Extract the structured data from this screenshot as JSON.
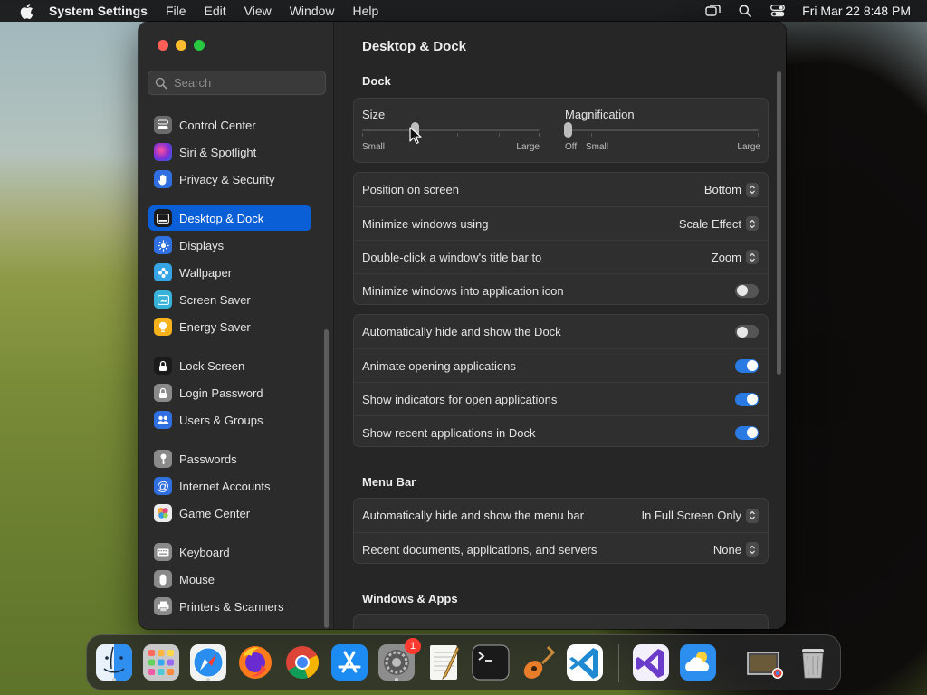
{
  "menubar": {
    "app_name": "System Settings",
    "menus": [
      "File",
      "Edit",
      "View",
      "Window",
      "Help"
    ],
    "clock": "Fri Mar 22  8:48 PM",
    "status_icons": [
      "screen-mirroring-icon",
      "spotlight-search-icon",
      "control-center-icon"
    ]
  },
  "search": {
    "placeholder": "Search"
  },
  "sidebar": {
    "items": [
      {
        "label": "Control Center",
        "icon": "control-center-icon",
        "color": "#6b6b6b"
      },
      {
        "label": "Siri & Spotlight",
        "icon": "siri-icon",
        "color": "#8e3ad6"
      },
      {
        "label": "Privacy & Security",
        "icon": "hand-icon",
        "color": "#2f6fe0"
      },
      {
        "label": "Desktop & Dock",
        "icon": "dock-icon",
        "color": "#1b1b1b",
        "selected": true
      },
      {
        "label": "Displays",
        "icon": "sun-icon",
        "color": "#2f6fe0"
      },
      {
        "label": "Wallpaper",
        "icon": "flower-icon",
        "color": "#35a5e6"
      },
      {
        "label": "Screen Saver",
        "icon": "screen-saver-icon",
        "color": "#37b3d9"
      },
      {
        "label": "Energy Saver",
        "icon": "bulb-icon",
        "color": "#f5b21a"
      },
      {
        "label": "Lock Screen",
        "icon": "lock-icon",
        "color": "#1b1b1b"
      },
      {
        "label": "Login Password",
        "icon": "lock-icon",
        "color": "#8a8a8a"
      },
      {
        "label": "Users & Groups",
        "icon": "users-icon",
        "color": "#2f6fe0"
      },
      {
        "label": "Passwords",
        "icon": "key-icon",
        "color": "#8a8a8a"
      },
      {
        "label": "Internet Accounts",
        "icon": "at-icon",
        "color": "#2f6fe0"
      },
      {
        "label": "Game Center",
        "icon": "game-center-icon",
        "color": "#e9e9e9"
      },
      {
        "label": "Keyboard",
        "icon": "keyboard-icon",
        "color": "#8a8a8a"
      },
      {
        "label": "Mouse",
        "icon": "mouse-icon",
        "color": "#8a8a8a"
      },
      {
        "label": "Printers & Scanners",
        "icon": "printer-icon",
        "color": "#8a8a8a"
      }
    ]
  },
  "content": {
    "title": "Desktop & Dock",
    "dock_section": "Dock",
    "size": {
      "label": "Size",
      "min_label": "Small",
      "max_label": "Large",
      "value_fraction": 0.3
    },
    "magnification": {
      "label": "Magnification",
      "off_label": "Off",
      "min_label": "Small",
      "max_label": "Large",
      "value_fraction": 0.0
    },
    "group1": [
      {
        "label": "Position on screen",
        "value": "Bottom"
      },
      {
        "label": "Minimize windows using",
        "value": "Scale Effect"
      },
      {
        "label": "Double-click a window's title bar to",
        "value": "Zoom"
      },
      {
        "label": "Minimize windows into application icon",
        "toggle": false
      }
    ],
    "group2": [
      {
        "label": "Automatically hide and show the Dock",
        "toggle": false
      },
      {
        "label": "Animate opening applications",
        "toggle": true
      },
      {
        "label": "Show indicators for open applications",
        "toggle": true
      },
      {
        "label": "Show recent applications in Dock",
        "toggle": true
      }
    ],
    "menubar_section": "Menu Bar",
    "group3": [
      {
        "label": "Automatically hide and show the menu bar",
        "value": "In Full Screen Only"
      },
      {
        "label": "Recent documents, applications, and servers",
        "value": "None"
      }
    ],
    "windows_section": "Windows & Apps"
  },
  "dock": {
    "apps": [
      "Finder",
      "Launchpad",
      "Safari",
      "Firefox",
      "Google Chrome",
      "App Store",
      "System Settings",
      "TextEdit",
      "Terminal",
      "GarageBand",
      "Visual Studio Code",
      "Visual Studio",
      "Weather",
      "Downloads",
      "Trash"
    ],
    "settings_badge": "1"
  }
}
